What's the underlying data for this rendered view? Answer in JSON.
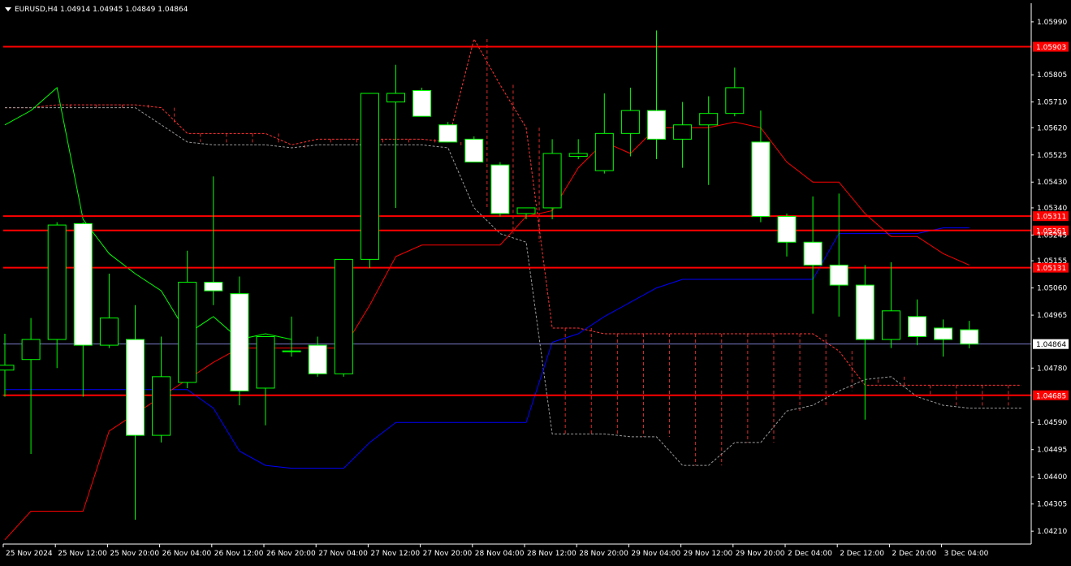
{
  "header": {
    "symbol": "EURUSD,H4",
    "ohlc": "1.04914 1.04945 1.04849 1.04864"
  },
  "colors": {
    "background": "#000000",
    "bull_candle": "#000000",
    "bear_candle": "#ffffff",
    "candle_outline": "#00ff00",
    "level_line": "#ff0000",
    "tenkan": "#ff0000",
    "kijun": "#0000ff",
    "chikou": "#00ff00",
    "cloud_bear": "#ff3333",
    "cloud_bull": "#999999",
    "current_price_line": "#7a7ac8"
  },
  "chart_data": {
    "type": "candlestick",
    "title": "",
    "symbol": "EURUSD",
    "timeframe": "H4",
    "ylim": [
      1.04165,
      1.06055
    ],
    "y_ticks": [
      "1.05990",
      "1.05805",
      "1.05710",
      "1.05620",
      "1.05525",
      "1.05430",
      "1.05340",
      "1.05245",
      "1.05155",
      "1.05060",
      "1.04965",
      "1.04780",
      "1.04590",
      "1.04495",
      "1.04400",
      "1.04305",
      "1.04210"
    ],
    "x_ticks": [
      "25 Nov 2024",
      "25 Nov 12:00",
      "25 Nov 20:00",
      "26 Nov 04:00",
      "26 Nov 12:00",
      "26 Nov 20:00",
      "27 Nov 04:00",
      "27 Nov 12:00",
      "27 Nov 20:00",
      "28 Nov 04:00",
      "28 Nov 12:00",
      "28 Nov 20:00",
      "29 Nov 04:00",
      "29 Nov 12:00",
      "29 Nov 20:00",
      "2 Dec 04:00",
      "2 Dec 12:00",
      "2 Dec 20:00",
      "3 Dec 04:00"
    ],
    "candles": [
      {
        "o": 1.04773,
        "h": 1.049,
        "l": 1.0468,
        "c": 1.0479
      },
      {
        "o": 1.0481,
        "h": 1.04955,
        "l": 1.0448,
        "c": 1.0488
      },
      {
        "o": 1.0488,
        "h": 1.0529,
        "l": 1.0478,
        "c": 1.0528
      },
      {
        "o": 1.05285,
        "h": 1.0529,
        "l": 1.0468,
        "c": 1.0486
      },
      {
        "o": 1.0486,
        "h": 1.0511,
        "l": 1.0485,
        "c": 1.04955
      },
      {
        "o": 1.0488,
        "h": 1.05,
        "l": 1.0425,
        "c": 1.04545
      },
      {
        "o": 1.04545,
        "h": 1.0489,
        "l": 1.0452,
        "c": 1.0475
      },
      {
        "o": 1.0473,
        "h": 1.0519,
        "l": 1.0471,
        "c": 1.0508
      },
      {
        "o": 1.0508,
        "h": 1.0545,
        "l": 1.05,
        "c": 1.0505
      },
      {
        "o": 1.0504,
        "h": 1.051,
        "l": 1.0465,
        "c": 1.047
      },
      {
        "o": 1.0471,
        "h": 1.0489,
        "l": 1.0458,
        "c": 1.0489
      },
      {
        "o": 1.0484,
        "h": 1.0496,
        "l": 1.0482,
        "c": 1.0484
      },
      {
        "o": 1.0486,
        "h": 1.0489,
        "l": 1.0475,
        "c": 1.0476
      },
      {
        "o": 1.0476,
        "h": 1.0514,
        "l": 1.0475,
        "c": 1.0516
      },
      {
        "o": 1.0516,
        "h": 1.0537,
        "l": 1.0513,
        "c": 1.0574
      },
      {
        "o": 1.0571,
        "h": 1.0584,
        "l": 1.0534,
        "c": 1.0574
      },
      {
        "o": 1.0575,
        "h": 1.0576,
        "l": 1.0566,
        "c": 1.0566
      },
      {
        "o": 1.0563,
        "h": 1.0564,
        "l": 1.0557,
        "c": 1.0557
      },
      {
        "o": 1.0558,
        "h": 1.0559,
        "l": 1.055,
        "c": 1.055
      },
      {
        "o": 1.0549,
        "h": 1.055,
        "l": 1.0531,
        "c": 1.0532
      },
      {
        "o": 1.0532,
        "h": 1.0534,
        "l": 1.053,
        "c": 1.0534
      },
      {
        "o": 1.0534,
        "h": 1.0558,
        "l": 1.053,
        "c": 1.0553
      },
      {
        "o": 1.0552,
        "h": 1.0558,
        "l": 1.0551,
        "c": 1.0553
      },
      {
        "o": 1.0547,
        "h": 1.0574,
        "l": 1.0546,
        "c": 1.056
      },
      {
        "o": 1.056,
        "h": 1.0576,
        "l": 1.0552,
        "c": 1.0568
      },
      {
        "o": 1.0568,
        "h": 1.0596,
        "l": 1.0551,
        "c": 1.0558
      },
      {
        "o": 1.0558,
        "h": 1.0571,
        "l": 1.0548,
        "c": 1.0563
      },
      {
        "o": 1.0563,
        "h": 1.0573,
        "l": 1.0542,
        "c": 1.0567
      },
      {
        "o": 1.0567,
        "h": 1.0583,
        "l": 1.0566,
        "c": 1.0576
      },
      {
        "o": 1.0557,
        "h": 1.0568,
        "l": 1.0529,
        "c": 1.0531
      },
      {
        "o": 1.0531,
        "h": 1.0532,
        "l": 1.0517,
        "c": 1.0522
      },
      {
        "o": 1.0522,
        "h": 1.0538,
        "l": 1.0497,
        "c": 1.0514
      },
      {
        "o": 1.0514,
        "h": 1.0539,
        "l": 1.0496,
        "c": 1.0507
      },
      {
        "o": 1.0507,
        "h": 1.0514,
        "l": 1.046,
        "c": 1.0488
      },
      {
        "o": 1.0488,
        "h": 1.0515,
        "l": 1.0485,
        "c": 1.0498
      },
      {
        "o": 1.0496,
        "h": 1.0502,
        "l": 1.0486,
        "c": 1.0489
      },
      {
        "o": 1.0492,
        "h": 1.0495,
        "l": 1.0482,
        "c": 1.0488
      },
      {
        "o": 1.04914,
        "h": 1.04945,
        "l": 1.04849,
        "c": 1.04864
      }
    ],
    "tenkan": [
      1.0418,
      1.0428,
      1.0428,
      1.0428,
      1.0456,
      1.0462,
      1.0468,
      1.0474,
      1.048,
      1.0485,
      1.0485,
      1.0485,
      1.0485,
      1.0485,
      1.05,
      1.0517,
      1.0521,
      1.0521,
      1.0521,
      1.0521,
      1.0531,
      1.0533,
      1.0548,
      1.0557,
      1.0553,
      1.0562,
      1.0562,
      1.0562,
      1.0564,
      1.0562,
      1.055,
      1.0543,
      1.0543,
      1.0532,
      1.0524,
      1.0524,
      1.0518,
      1.0514
    ],
    "kijun": [
      1.04705,
      1.04705,
      1.04705,
      1.04705,
      1.04705,
      1.04705,
      1.04705,
      1.04705,
      1.0464,
      1.0449,
      1.0444,
      1.0443,
      1.0443,
      1.0443,
      1.0452,
      1.0459,
      1.0459,
      1.0459,
      1.0459,
      1.0459,
      1.0459,
      1.0487,
      1.049,
      1.0496,
      1.0501,
      1.0506,
      1.0509,
      1.0509,
      1.0509,
      1.0509,
      1.0509,
      1.0509,
      1.0525,
      1.0525,
      1.0525,
      1.0525,
      1.0527,
      1.0527
    ],
    "chikou": [
      1.0563,
      1.0568,
      1.0576,
      1.053,
      1.0518,
      1.0511,
      1.0505,
      1.049,
      1.0496,
      1.0488,
      1.049,
      1.0488
    ],
    "cloud_upper": [
      1.0569,
      1.0569,
      1.057,
      1.057,
      1.057,
      1.057,
      1.0569,
      1.056,
      1.056,
      1.056,
      1.056,
      1.0556,
      1.0558,
      1.0558,
      1.0558,
      1.0558,
      1.0558,
      1.0557,
      1.0593,
      1.0577,
      1.0562,
      1.0492,
      1.0492,
      1.049,
      1.049,
      1.049,
      1.049,
      1.049,
      1.049,
      1.049,
      1.049,
      1.049,
      1.0484,
      1.0472,
      1.0472,
      1.0472,
      1.0472,
      1.0472,
      1.0472,
      1.0472
    ],
    "cloud_lower": [
      1.0569,
      1.0569,
      1.0569,
      1.0569,
      1.0569,
      1.0569,
      1.0563,
      1.0557,
      1.0556,
      1.0556,
      1.0556,
      1.0555,
      1.0556,
      1.0556,
      1.0556,
      1.0556,
      1.0556,
      1.0555,
      1.0534,
      1.0525,
      1.0522,
      1.0455,
      1.0455,
      1.0455,
      1.0454,
      1.0454,
      1.0444,
      1.0444,
      1.0452,
      1.0452,
      1.0463,
      1.0465,
      1.047,
      1.0474,
      1.0475,
      1.0468,
      1.0465,
      1.0464,
      1.0464,
      1.0464
    ],
    "levels": [
      "1.05903",
      "1.05311",
      "1.05261",
      "1.05131",
      "1.04685"
    ],
    "current_price": "1.04864"
  }
}
